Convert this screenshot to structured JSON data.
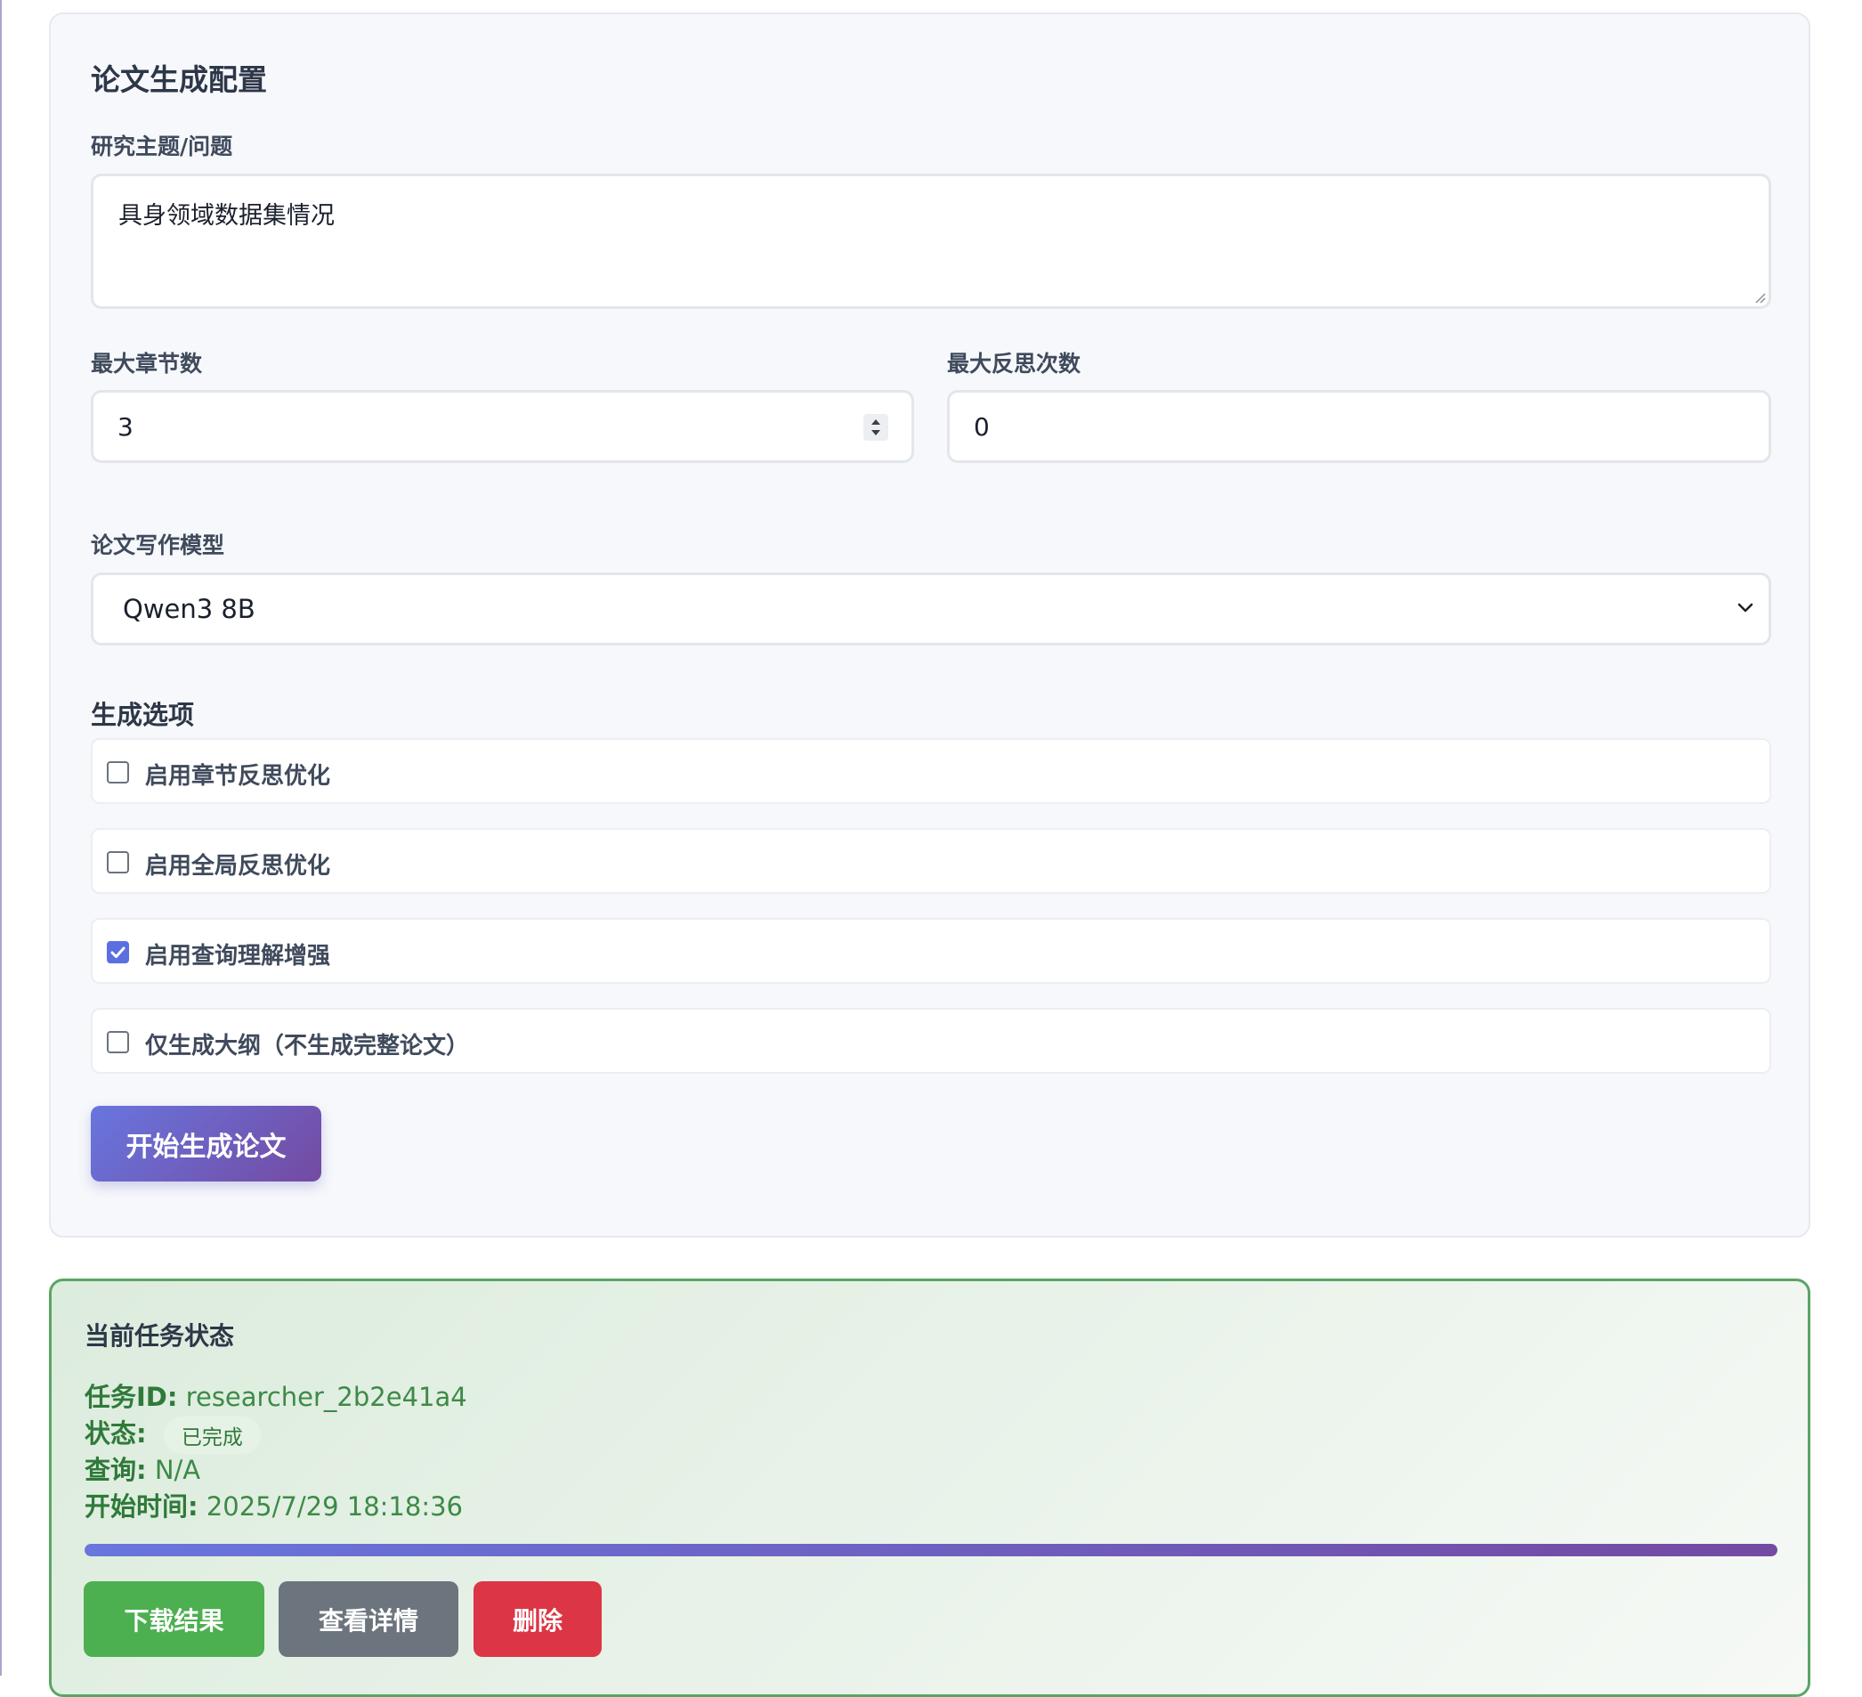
{
  "config": {
    "title": "论文生成配置",
    "topic_label": "研究主题/问题",
    "topic_value": "具身领域数据集情况",
    "max_sections_label": "最大章节数",
    "max_sections_value": "3",
    "max_reflections_label": "最大反思次数",
    "max_reflections_value": "0",
    "model_label": "论文写作模型",
    "model_value": "Qwen3 8B",
    "options_title": "生成选项",
    "options": [
      {
        "label": "启用章节反思优化",
        "checked": false
      },
      {
        "label": "启用全局反思优化",
        "checked": false
      },
      {
        "label": "启用查询理解增强",
        "checked": true
      },
      {
        "label": "仅生成大纲（不生成完整论文）",
        "checked": false
      }
    ],
    "start_button": "开始生成论文"
  },
  "task": {
    "title": "当前任务状态",
    "id_key": "任务ID:",
    "id_value": "researcher_2b2e41a4",
    "status_key": "状态:",
    "status_value": "已完成",
    "query_key": "查询:",
    "query_value": "N/A",
    "start_time_key": "开始时间:",
    "start_time_value": "2025/7/29 18:18:36",
    "progress_percent": 100,
    "download_button": "下载结果",
    "details_button": "查看详情",
    "delete_button": "删除"
  },
  "colors": {
    "accent_start": "#6876de",
    "accent_end": "#744aa2",
    "success": "#4caf50",
    "secondary": "#6c757d",
    "danger": "#dc3545",
    "status_border": "#5aa565"
  },
  "icons": {
    "checkbox_checked": "checkmark-icon",
    "select_arrow": "chevron-down-icon",
    "number_spinner": "spinner-arrows-icon"
  }
}
